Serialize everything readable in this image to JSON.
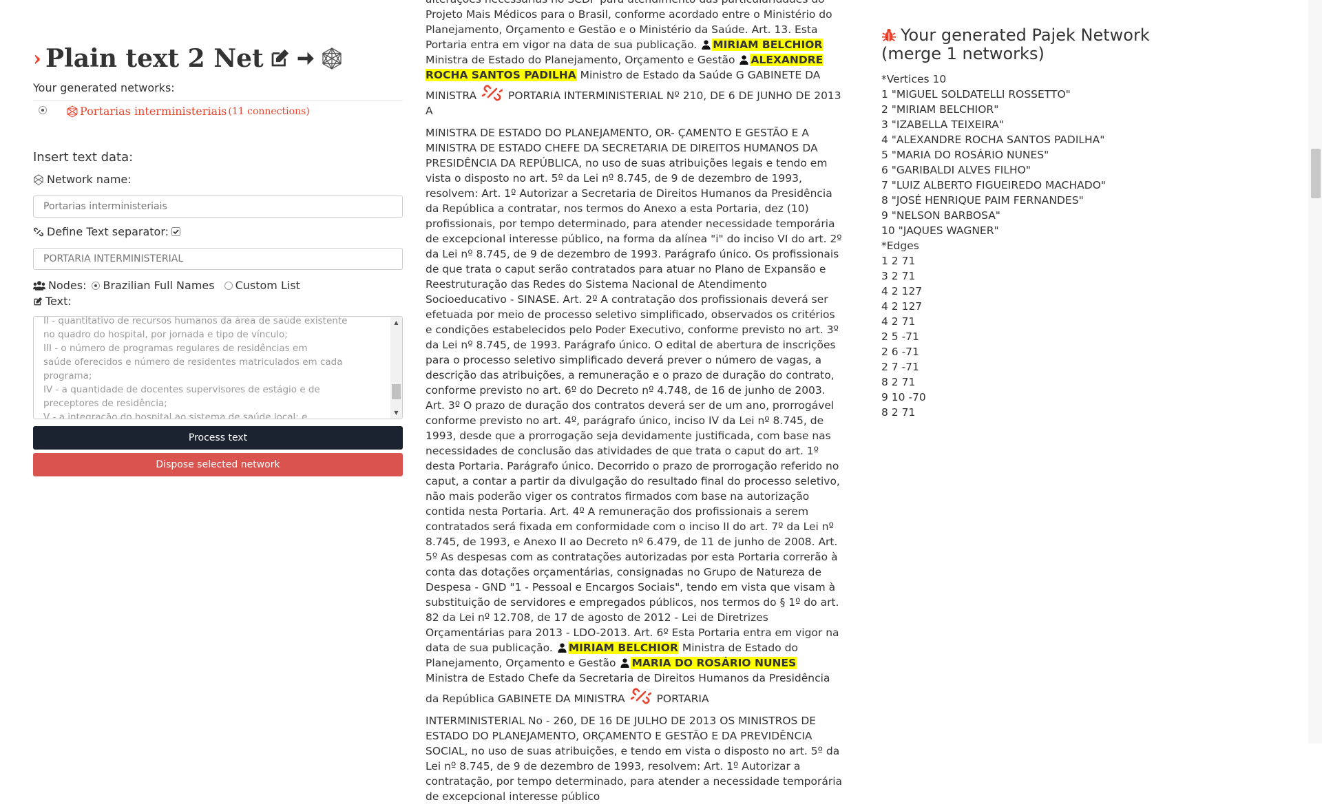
{
  "app": {
    "title": "Plain text 2 Net",
    "generated_label": "Your generated networks:",
    "networks": [
      {
        "name": "Portarias interministeriais",
        "connections": "(11 connections)",
        "selected": true
      }
    ]
  },
  "form": {
    "insert_label": "Insert text data:",
    "network_name_label": "Network name:",
    "network_name_placeholder": "Portarias interministeriais",
    "separator_label": "Define Text separator:",
    "separator_placeholder": "PORTARIA INTERMINISTERIAL",
    "nodes_label": "Nodes:",
    "node_options": [
      "Brazilian Full Names",
      "Custom List"
    ],
    "text_label": "Text:",
    "text_value": "II - quantitativo de recursos humanos da área de saúde existente\nno quadro do hospital, por jornada e tipo de vínculo;\nIII - o número de programas regulares de residências em\nsaúde oferecidos e número de residentes matriculados em cada\nprograma;\nIV - a quantidade de docentes supervisores de estágio e de\npreceptores de residência;\nV - a integração do hospital ao sistema de saúde local; e",
    "process_button": "Process text",
    "dispose_button": "Dispose selected network"
  },
  "document": {
    "p1": {
      "t1": "alterações necessárias no SCDP para atendimento das particularidades do Projeto Mais Médicos para o Brasil, conforme acordado entre o Ministério do Planejamento, Orçamento e Gestão e o Ministério da Saúde. Art. 13. Esta Portaria entra em vigor na data de sua publicação.",
      "n1": "MIRIAM BELCHIOR",
      "t2": "Ministra de Estado do Planejamento, Orçamento e Gestão",
      "n2": "ALEXANDRE ROCHA SANTOS PADILHA",
      "t3": "Ministro de Estado da Saúde G GABINETE DA MINISTRA",
      "t4": "PORTARIA INTERMINISTERIAL Nº 210, DE 6 DE JUNHO DE 2013 A"
    },
    "p2": {
      "t1": "MINISTRA DE ESTADO DO PLANEJAMENTO, OR- ÇAMENTO E GESTÃO E A MINISTRA DE ESTADO CHEFE DA SECRETARIA DE DIREITOS HUMANOS DA PRESIDÊNCIA DA REPÚBLICA, no uso de suas atribuições legais e tendo em vista o disposto no art. 5º da Lei nº 8.745, de 9 de dezembro de 1993, resolvem: Art. 1º Autorizar a Secretaria de Direitos Humanos da Presidência da República a contratar, nos termos do Anexo a esta Portaria, dez (10) profissionais, por tempo determinado, para atender necessidade temporária de excepcional interesse público, na forma da alínea \"i\" do inciso VI do art. 2º da Lei nº 8.745, de 9 de dezembro de 1993. Parágrafo único. Os profissionais de que trata o caput serão contratados para atuar no Plano de Expansão e Reestruturação das Redes do Sistema Nacional de Atendimento Socioeducativo - SINASE. Art. 2º A contratação dos profissionais deverá ser efetuada por meio de processo seletivo simplificado, observados os critérios e condições estabelecidos pelo Poder Executivo, conforme previsto no art. 3º da Lei nº 8.745, de 1993. Parágrafo único. O edital de abertura de inscrições para o processo seletivo simplificado deverá prever o número de vagas, a descrição das atribuições, a remuneração e o prazo de duração do contrato, conforme previsto no art. 6º do Decreto nº 4.748, de 16 de junho de 2003. Art. 3º O prazo de duração dos contratos deverá ser de um ano, prorrogável conforme previsto no art. 4º, parágrafo único, inciso IV da Lei nº 8.745, de 1993, desde que a prorrogação seja devidamente justificada, com base nas necessidades de conclusão das atividades de que trata o caput do art. 1º desta Portaria. Parágrafo único. Decorrido o prazo de prorrogação referido no caput, a contar a partir da divulgação do resultado final do processo seletivo, não mais poderão viger os contratos firmados com base na autorização contida nesta Portaria. Art. 4º A remuneração dos profissionais a serem contratados será fixada em conformidade com o inciso II do art. 7º da Lei nº 8.745, de 1993, e Anexo II ao Decreto nº 6.479, de 11 de junho de 2008. Art. 5º As despesas com as contratações autorizadas por esta Portaria correrão à conta das dotações orçamentárias, consignadas no Grupo de Natureza de Despesa - GND \"1 - Pessoal e Encargos Sociais\", tendo em vista que visam à substituição de servidores e empregados públicos, nos termos do § 1º do art. 82 da Lei nº 12.708, de 17 de agosto de 2012 - Lei de Diretrizes Orçamentárias para 2013 - LDO-2013. Art. 6º Esta Portaria entra em vigor na data de sua publicação.",
      "n1": "MIRIAM BELCHIOR",
      "t2": "Ministra de Estado do Planejamento, Orçamento e Gestão",
      "n2": "MARIA DO ROSÁRIO NUNES",
      "t3": "Ministra de Estado Chefe da Secretaria de Direitos Humanos da Presidência da República GABINETE DA MINISTRA",
      "t4": "PORTARIA"
    },
    "p3": {
      "t1": "INTERMINISTERIAL No - 260, DE 16 DE JULHO DE 2013 OS MINISTROS DE ESTADO DO PLANEJAMENTO, ORÇAMENTO E GESTÃO E DA PREVIDÊNCIA SOCIAL, no uso de suas atribuições, e tendo em vista o disposto no art. 5º da Lei nº 8.745, de 9 de dezembro de 1993, resolvem: Art. 1º Autorizar a contratação, por tempo determinado, para atender a necessidade temporária de excepcional interesse público"
    }
  },
  "pajek": {
    "title_line1": "Your generated Pajek Network",
    "title_line2": "(merge 1 networks)",
    "lines": [
      "*Vertices 10",
      "1 \"MIGUEL SOLDATELLI ROSSETTO\"",
      "2 \"MIRIAM BELCHIOR\"",
      "3 \"IZABELLA TEIXEIRA\"",
      "4 \"ALEXANDRE ROCHA SANTOS PADILHA\"",
      "5 \"MARIA DO ROSÁRIO NUNES\"",
      "6 \"GARIBALDI ALVES FILHO\"",
      "7 \"LUIZ ALBERTO FIGUEIREDO MACHADO\"",
      "8 \"JOSÉ HENRIQUE PAIM FERNANDES\"",
      "9 \"NELSON BARBOSA\"",
      "10 \"JAQUES WAGNER\"",
      "*Edges",
      "1 2 71",
      "3 2 71",
      "4 2 127",
      "4 2 127",
      "4 2 71",
      "2 5 -71",
      "2 6 -71",
      "2 7 -71",
      "8 2 71",
      "9 10 -70",
      "8 2 71"
    ]
  },
  "colors": {
    "accent_red": "#e8412c",
    "highlight": "#ffff00",
    "button_dark": "#1b2330",
    "button_red": "#d9534f"
  },
  "icons": [
    "chevron-right-icon",
    "edit-icon",
    "arrow-right-icon",
    "network-icon",
    "users-icon",
    "separator-icon",
    "person-icon",
    "bug-icon"
  ]
}
